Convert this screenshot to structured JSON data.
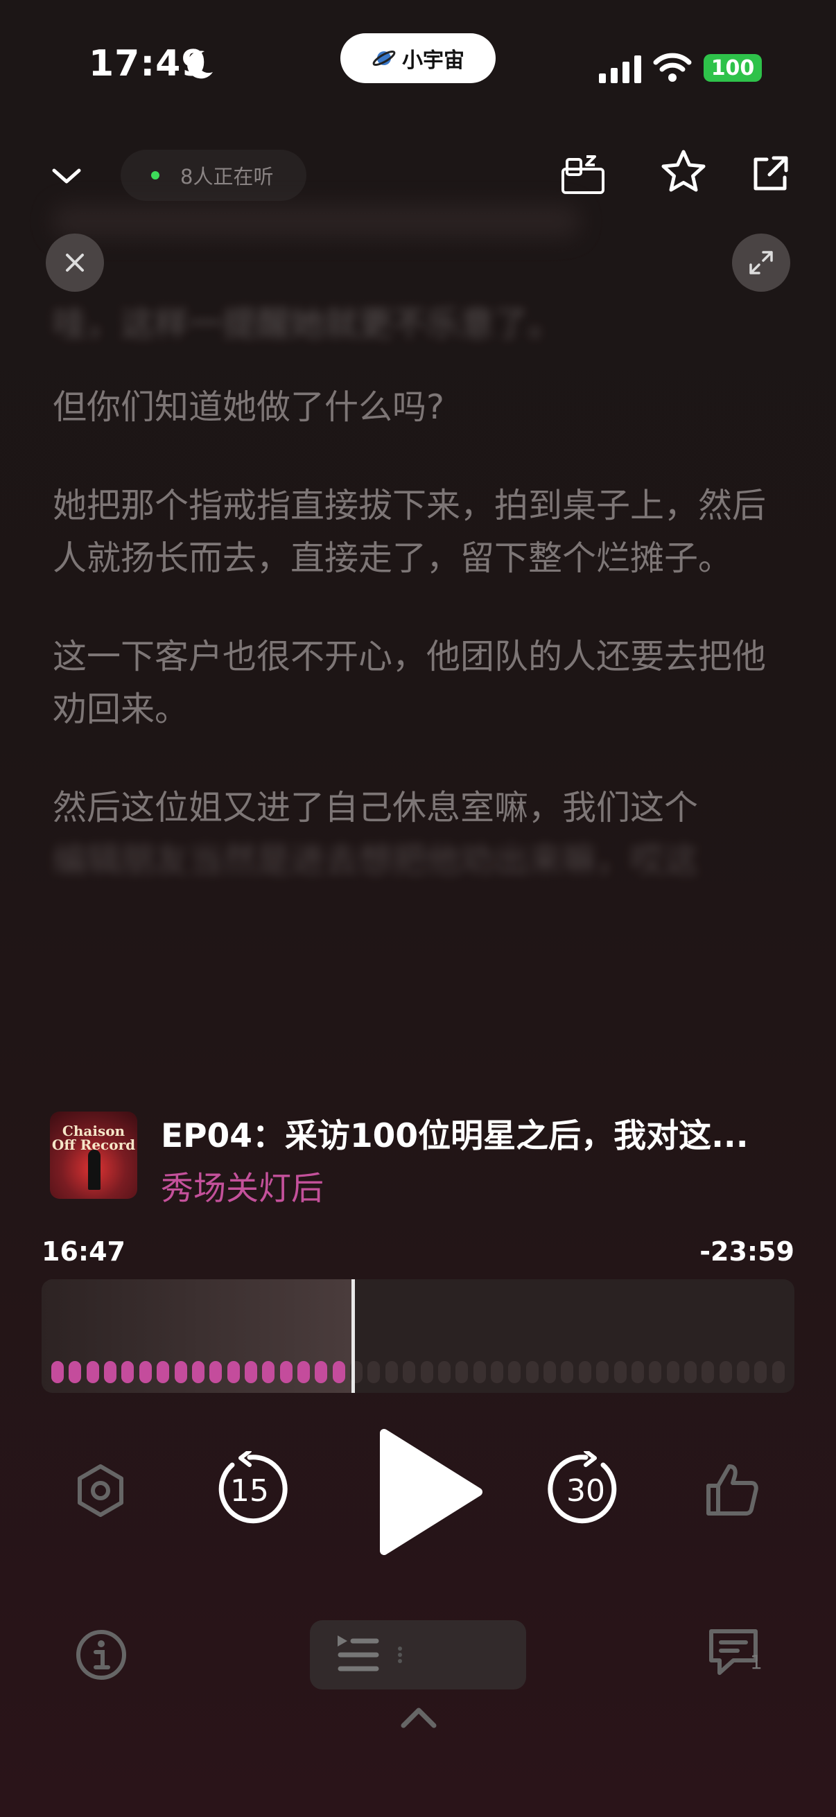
{
  "status": {
    "time": "17:49",
    "island_label": "小宇宙",
    "battery": "100"
  },
  "header": {
    "listeners": "8人正在听"
  },
  "transcript": {
    "blurred_lines": [
      "哇，这样一提醒她就更不乐意了。"
    ],
    "paragraphs": [
      "但你们知道她做了什么吗?",
      "她把那个指戒指直接拔下来，拍到桌子上，然后人就扬长而去，直接走了，留下整个烂摊子。",
      "这一下客户也很不开心，他团队的人还要去把他劝回来。"
    ],
    "last_paragraph_visible": "然后这位姐又进了自己休息室嘛，我们这个",
    "last_paragraph_faded": "编辑朋友当然是进去想把他劝出来嘛，哎这"
  },
  "episode": {
    "title": "EP04：采访100位明星之后，我对这...",
    "show": "秀场关灯后",
    "cover_text": "Chaison Off Record"
  },
  "player": {
    "elapsed": "16:47",
    "remaining": "-23:59",
    "progress": 0.4117,
    "rewind_seconds": "15",
    "forward_seconds": "30",
    "comment_count": "1"
  },
  "colors": {
    "accent": "#c4519b",
    "live_dot": "#3ddc5a",
    "battery": "#2ec24a"
  }
}
